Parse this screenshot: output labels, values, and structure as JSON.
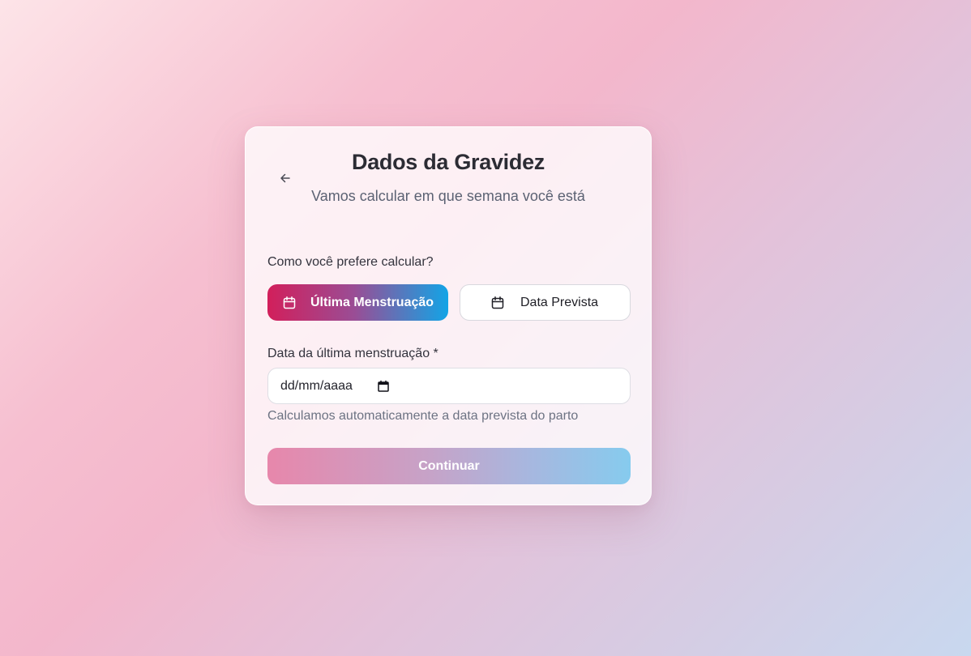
{
  "header": {
    "title": "Dados da Gravidez",
    "subtitle": "Vamos calcular em que semana você está",
    "back_icon": "arrow-left-icon"
  },
  "method": {
    "label": "Como você prefere calcular?",
    "options": [
      {
        "label": "Última Menstruação",
        "icon": "calendar-icon",
        "selected": true
      },
      {
        "label": "Data Prevista",
        "icon": "calendar-icon",
        "selected": false
      }
    ]
  },
  "date_field": {
    "label": "Data da última menstruação *",
    "placeholder": "dd/mm/aaaa",
    "icon": "calendar-icon",
    "hint": "Calculamos automaticamente a data prevista do parto"
  },
  "actions": {
    "continue_label": "Continuar",
    "continue_enabled": false
  },
  "colors": {
    "accent_start": "#d21f5b",
    "accent_end": "#12a4e6",
    "title": "#2c2c34"
  }
}
